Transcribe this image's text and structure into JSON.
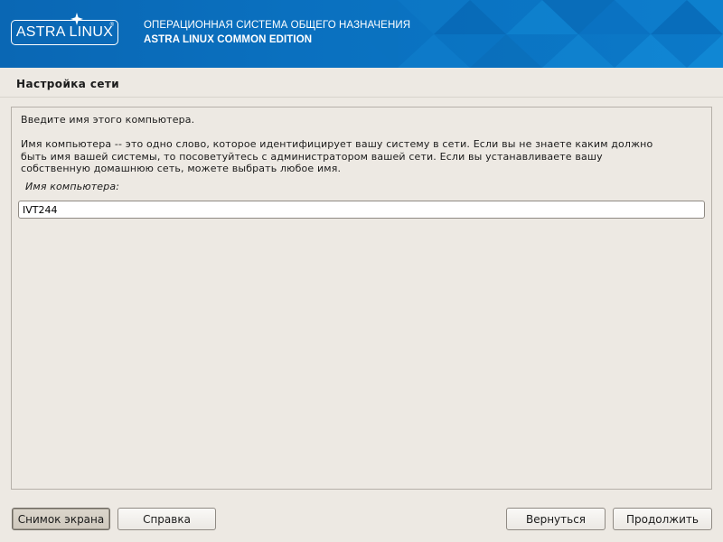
{
  "banner": {
    "logo_text": "ASTRA LINUX",
    "logo_reg": "®",
    "line1": "ОПЕРАЦИОННАЯ СИСТЕМА ОБЩЕГО НАЗНАЧЕНИЯ",
    "line2": "ASTRA LINUX COMMON EDITION"
  },
  "page": {
    "title": "Настройка сети"
  },
  "content": {
    "intro": "Введите имя этого компьютера.",
    "description": "Имя компьютера -- это одно слово, которое идентифицирует вашу систему в сети. Если вы не знаете каким должно\nбыть имя вашей системы, то посоветуйтесь с администратором вашей сети. Если вы устанавливаете вашу\nсобственную домашнюю сеть, можете выбрать любое имя.",
    "field_label": "Имя компьютера:",
    "hostname_value": "IVT244"
  },
  "buttons": {
    "screenshot": "Снимок экрана",
    "help": "Справка",
    "back": "Вернуться",
    "continue": "Продолжить"
  },
  "colors": {
    "banner_blue": "#0a70bf",
    "background": "#ede9e3"
  }
}
